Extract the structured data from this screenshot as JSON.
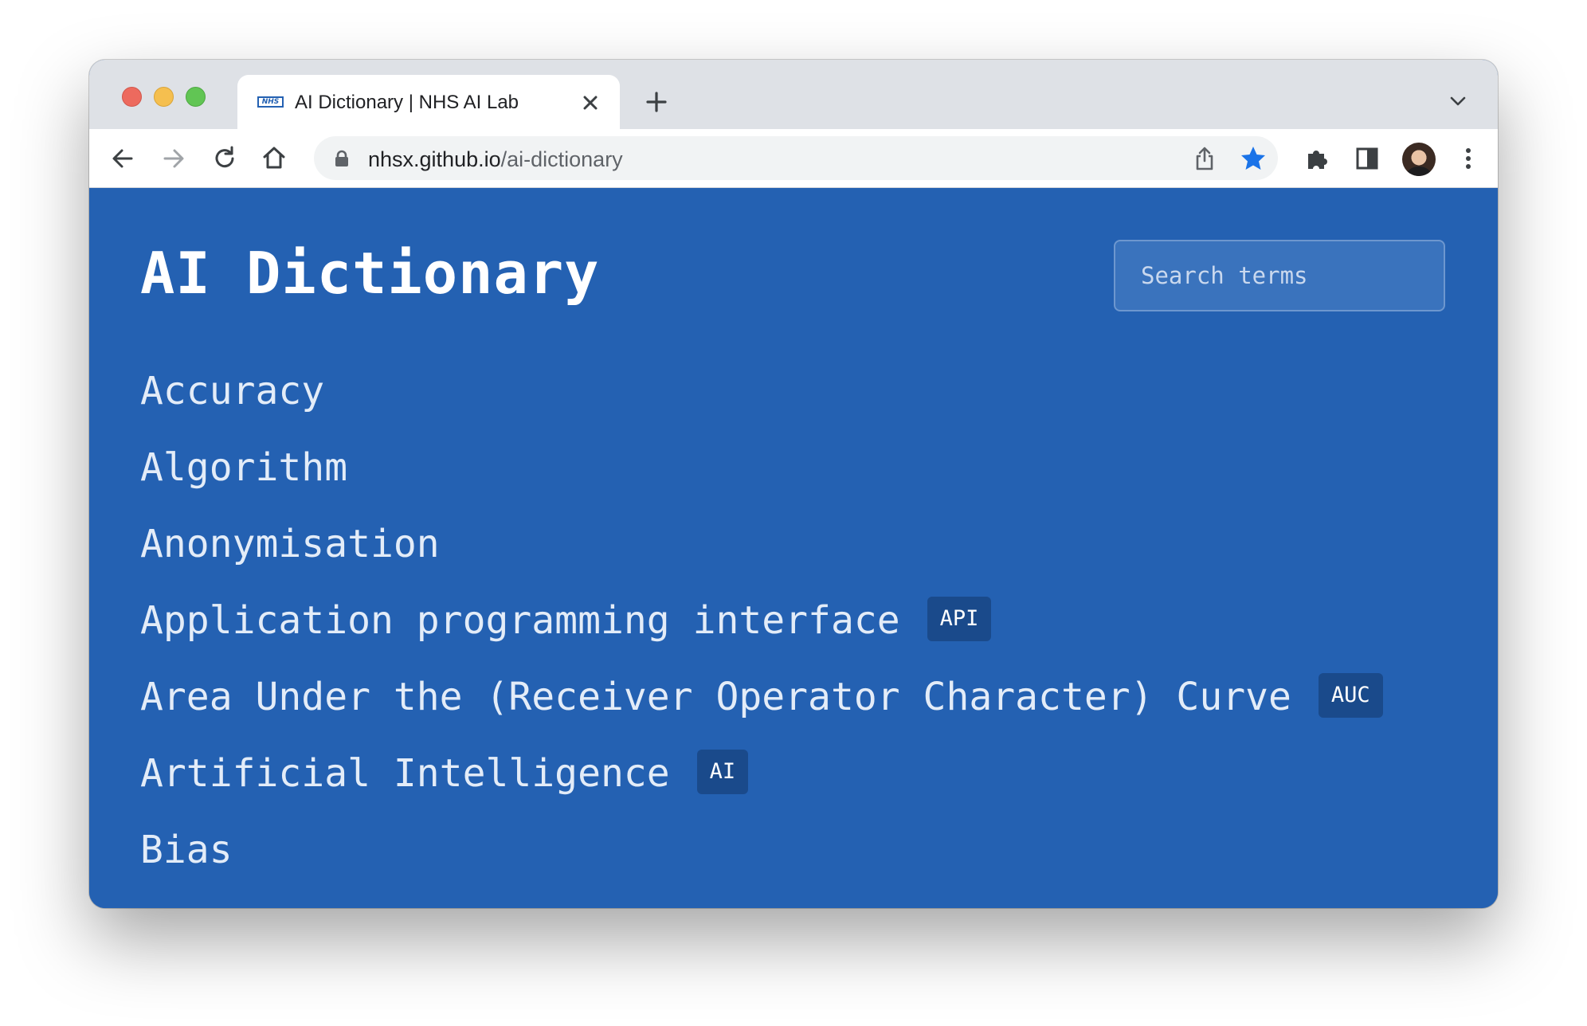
{
  "browser": {
    "tab": {
      "title": "AI Dictionary | NHS AI Lab",
      "favicon_text": "NHS"
    },
    "url": {
      "host": "nhsx.github.io",
      "path": "/ai-dictionary"
    },
    "bookmark_color": "#1a73e8"
  },
  "page": {
    "title": "AI Dictionary",
    "search": {
      "placeholder": "Search terms",
      "value": ""
    },
    "background_color": "#2461b2",
    "terms": [
      {
        "label": "Accuracy",
        "abbr": ""
      },
      {
        "label": "Algorithm",
        "abbr": ""
      },
      {
        "label": "Anonymisation",
        "abbr": ""
      },
      {
        "label": "Application programming interface",
        "abbr": "API"
      },
      {
        "label": "Area Under the (Receiver Operator Character) Curve",
        "abbr": "AUC"
      },
      {
        "label": "Artificial Intelligence",
        "abbr": "AI"
      },
      {
        "label": "Bias",
        "abbr": ""
      }
    ]
  }
}
